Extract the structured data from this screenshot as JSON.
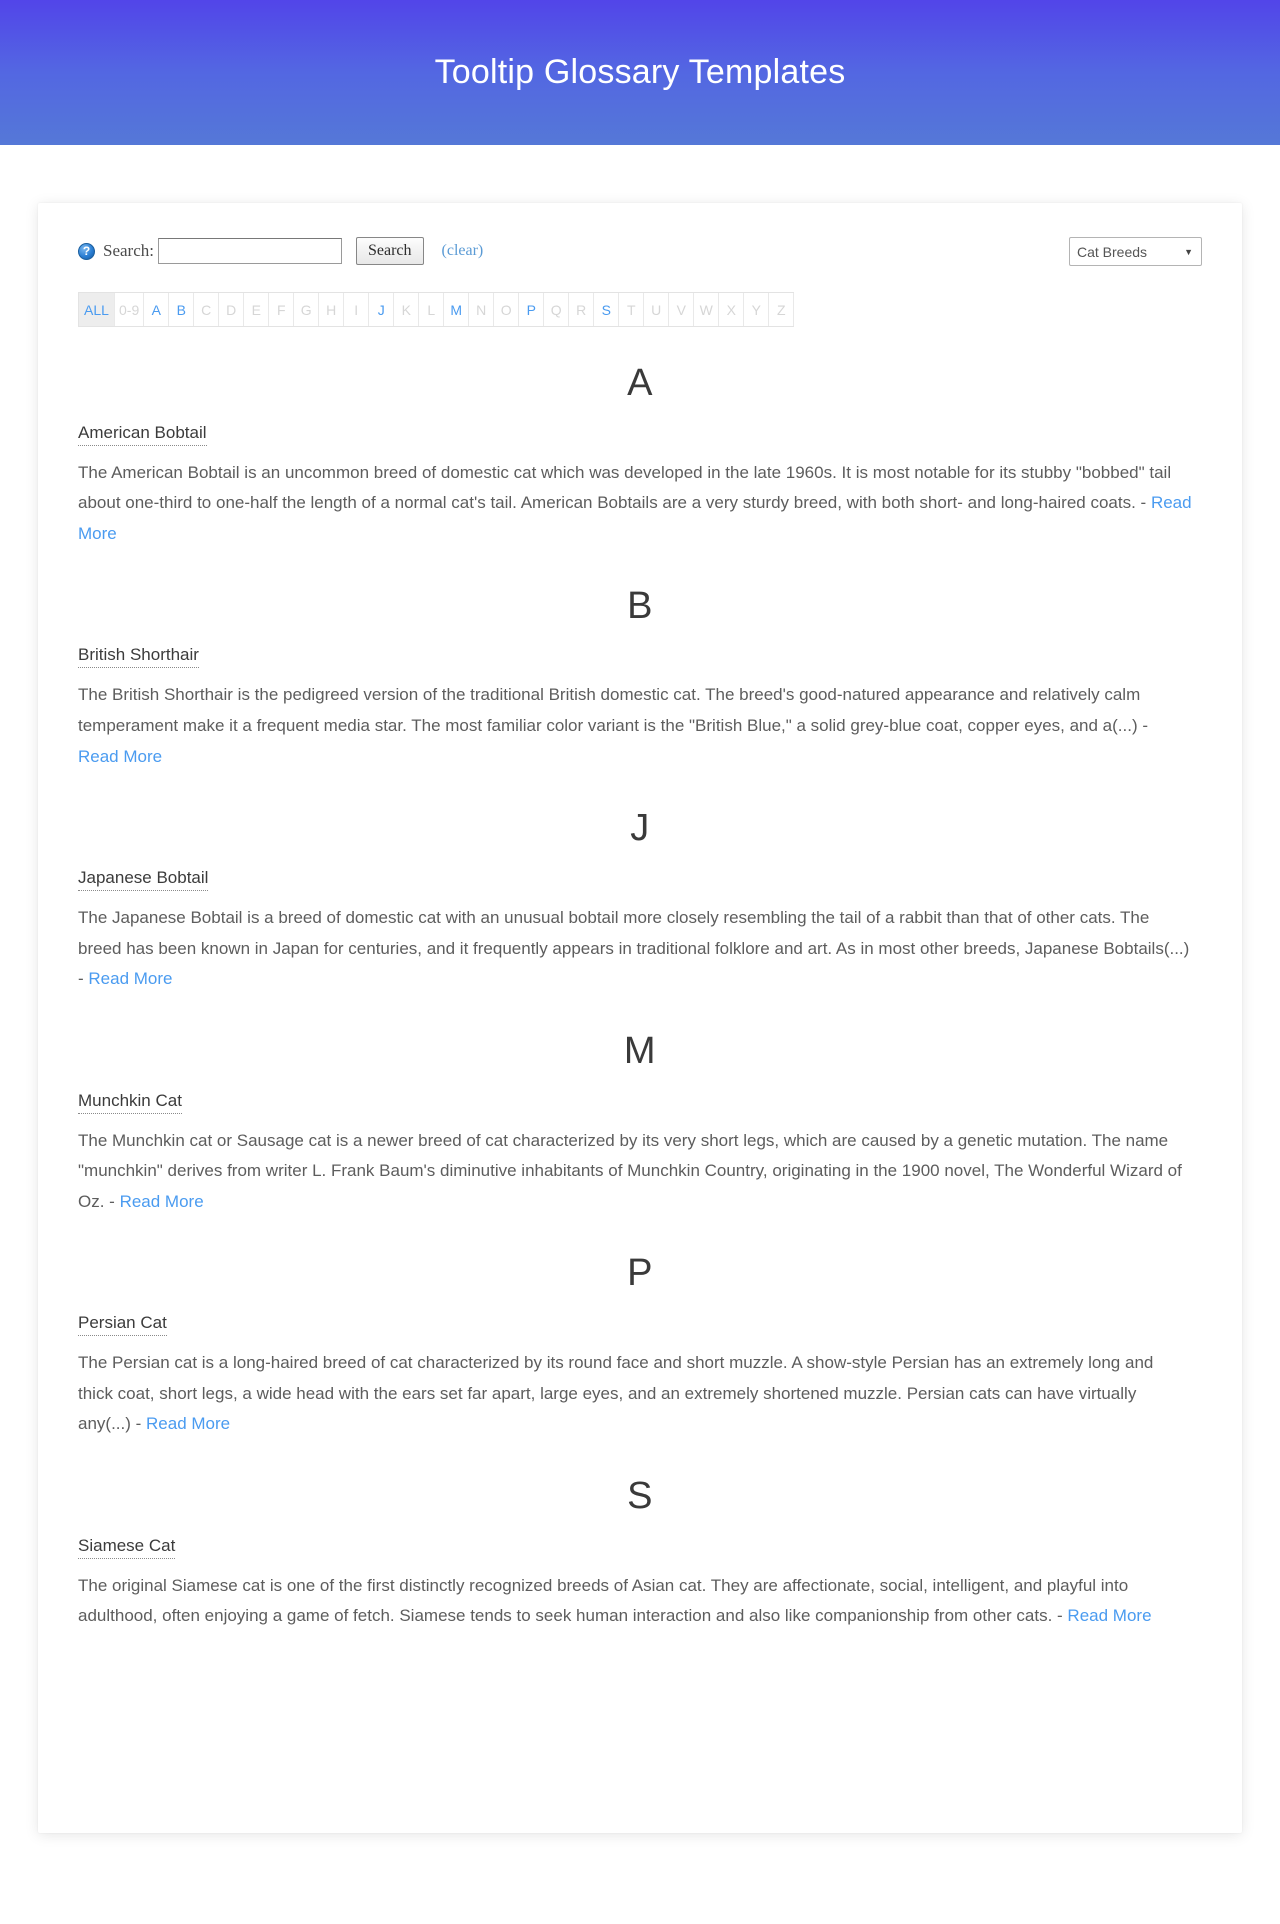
{
  "header": {
    "title": "Tooltip Glossary Templates"
  },
  "toolbar": {
    "help_icon": "help-circle-icon",
    "search_label": "Search:",
    "search_value": "",
    "search_placeholder": "",
    "search_button": "Search",
    "clear_link": "(clear)",
    "select_value": "Cat Breeds",
    "select_arrow": "▼"
  },
  "alpha_index": {
    "all_label": "ALL",
    "items": [
      {
        "label": "0-9",
        "active": false
      },
      {
        "label": "A",
        "active": true
      },
      {
        "label": "B",
        "active": true
      },
      {
        "label": "C",
        "active": false
      },
      {
        "label": "D",
        "active": false
      },
      {
        "label": "E",
        "active": false
      },
      {
        "label": "F",
        "active": false
      },
      {
        "label": "G",
        "active": false
      },
      {
        "label": "H",
        "active": false
      },
      {
        "label": "I",
        "active": false
      },
      {
        "label": "J",
        "active": true
      },
      {
        "label": "K",
        "active": false
      },
      {
        "label": "L",
        "active": false
      },
      {
        "label": "M",
        "active": true
      },
      {
        "label": "N",
        "active": false
      },
      {
        "label": "O",
        "active": false
      },
      {
        "label": "P",
        "active": true
      },
      {
        "label": "Q",
        "active": false
      },
      {
        "label": "R",
        "active": false
      },
      {
        "label": "S",
        "active": true
      },
      {
        "label": "T",
        "active": false
      },
      {
        "label": "U",
        "active": false
      },
      {
        "label": "V",
        "active": false
      },
      {
        "label": "W",
        "active": false
      },
      {
        "label": "X",
        "active": false
      },
      {
        "label": "Y",
        "active": false
      },
      {
        "label": "Z",
        "active": false
      }
    ]
  },
  "read_more_label": "Read More",
  "glossary": [
    {
      "letter": "A",
      "term": "American Bobtail",
      "description": "The American Bobtail is an uncommon breed of domestic cat which was developed in the late 1960s. It is most notable for its stubby \"bobbed\" tail about one-third to one-half the length of a normal cat's tail. American Bobtails are a very sturdy breed, with both short- and long-haired coats. - ",
      "read_more": "Read More"
    },
    {
      "letter": "B",
      "term": "British Shorthair",
      "description": "The British Shorthair is the pedigreed version of the traditional British domestic cat. The breed's good-natured appearance and relatively calm temperament make it a frequent media star. The most familiar color variant is the \"British Blue,\" a solid grey-blue coat, copper eyes, and a(...) - ",
      "read_more": "Read More"
    },
    {
      "letter": "J",
      "term": "Japanese Bobtail",
      "description": "The Japanese Bobtail is a breed of domestic cat with an unusual bobtail more closely resembling the tail of a rabbit than that of other cats. The breed has been known in Japan for centuries, and it frequently appears in traditional folklore and art. As in most other breeds, Japanese Bobtails(...) - ",
      "read_more": "Read More"
    },
    {
      "letter": "M",
      "term": "Munchkin Cat",
      "description": "The Munchkin cat or Sausage cat is a newer breed of cat characterized by its very short legs, which are caused by a genetic mutation. The name \"munchkin\" derives from writer L. Frank Baum's diminutive inhabitants of Munchkin Country, originating in the 1900 novel, The Wonderful Wizard of Oz. - ",
      "read_more": "Read More"
    },
    {
      "letter": "P",
      "term": "Persian Cat",
      "description": "The Persian cat is a long-haired breed of cat characterized by its round face and short muzzle. A show-style Persian has an extremely long and thick coat, short legs, a wide head with the ears set far apart, large eyes, and an extremely shortened muzzle. Persian cats can have virtually any(...) - ",
      "read_more": "Read More"
    },
    {
      "letter": "S",
      "term": "Siamese Cat",
      "description": "The original Siamese cat is one of the first distinctly recognized breeds of Asian cat. They are affectionate, social, intelligent, and playful into adulthood, often enjoying a game of fetch. Siamese tends to seek human interaction and also like companionship from other cats. - ",
      "read_more": "Read More"
    }
  ],
  "colors": {
    "header_gradient_start": "#5245e9",
    "header_gradient_end": "#5578d7",
    "link_blue": "#4a9bf0",
    "clear_blue": "#5b9bd5",
    "text_gray": "#5d5d5d",
    "inactive_letter": "#d6d6d6"
  }
}
